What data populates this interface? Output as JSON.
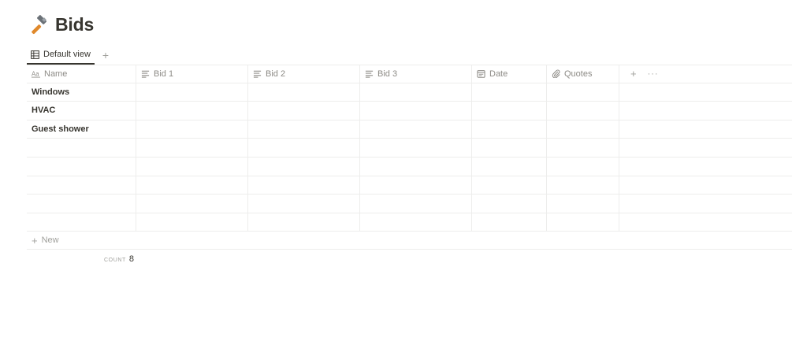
{
  "page": {
    "icon": "hammer-icon",
    "title": "Bids"
  },
  "views": {
    "active_tab": "Default view",
    "tab_icon": "table-icon",
    "add_icon": "+"
  },
  "table": {
    "columns": [
      {
        "label": "Name",
        "icon": "title-text-icon"
      },
      {
        "label": "Bid 1",
        "icon": "text-lines-icon"
      },
      {
        "label": "Bid 2",
        "icon": "text-lines-icon"
      },
      {
        "label": "Bid 3",
        "icon": "text-lines-icon"
      },
      {
        "label": "Date",
        "icon": "calendar-icon"
      },
      {
        "label": "Quotes",
        "icon": "paperclip-icon"
      }
    ],
    "add_column": "+",
    "more": "···",
    "rows": [
      {
        "name": "Windows"
      },
      {
        "name": "HVAC"
      },
      {
        "name": "Guest shower"
      },
      {
        "name": ""
      },
      {
        "name": ""
      },
      {
        "name": ""
      },
      {
        "name": ""
      },
      {
        "name": ""
      }
    ],
    "new_row": {
      "icon": "+",
      "label": "New"
    }
  },
  "footer": {
    "count_label": "COUNT",
    "count_value": "8"
  },
  "colors": {
    "text": "#37352f",
    "muted": "#8d8b86",
    "border": "#ededec",
    "hammer_handle": "#d2691e"
  }
}
